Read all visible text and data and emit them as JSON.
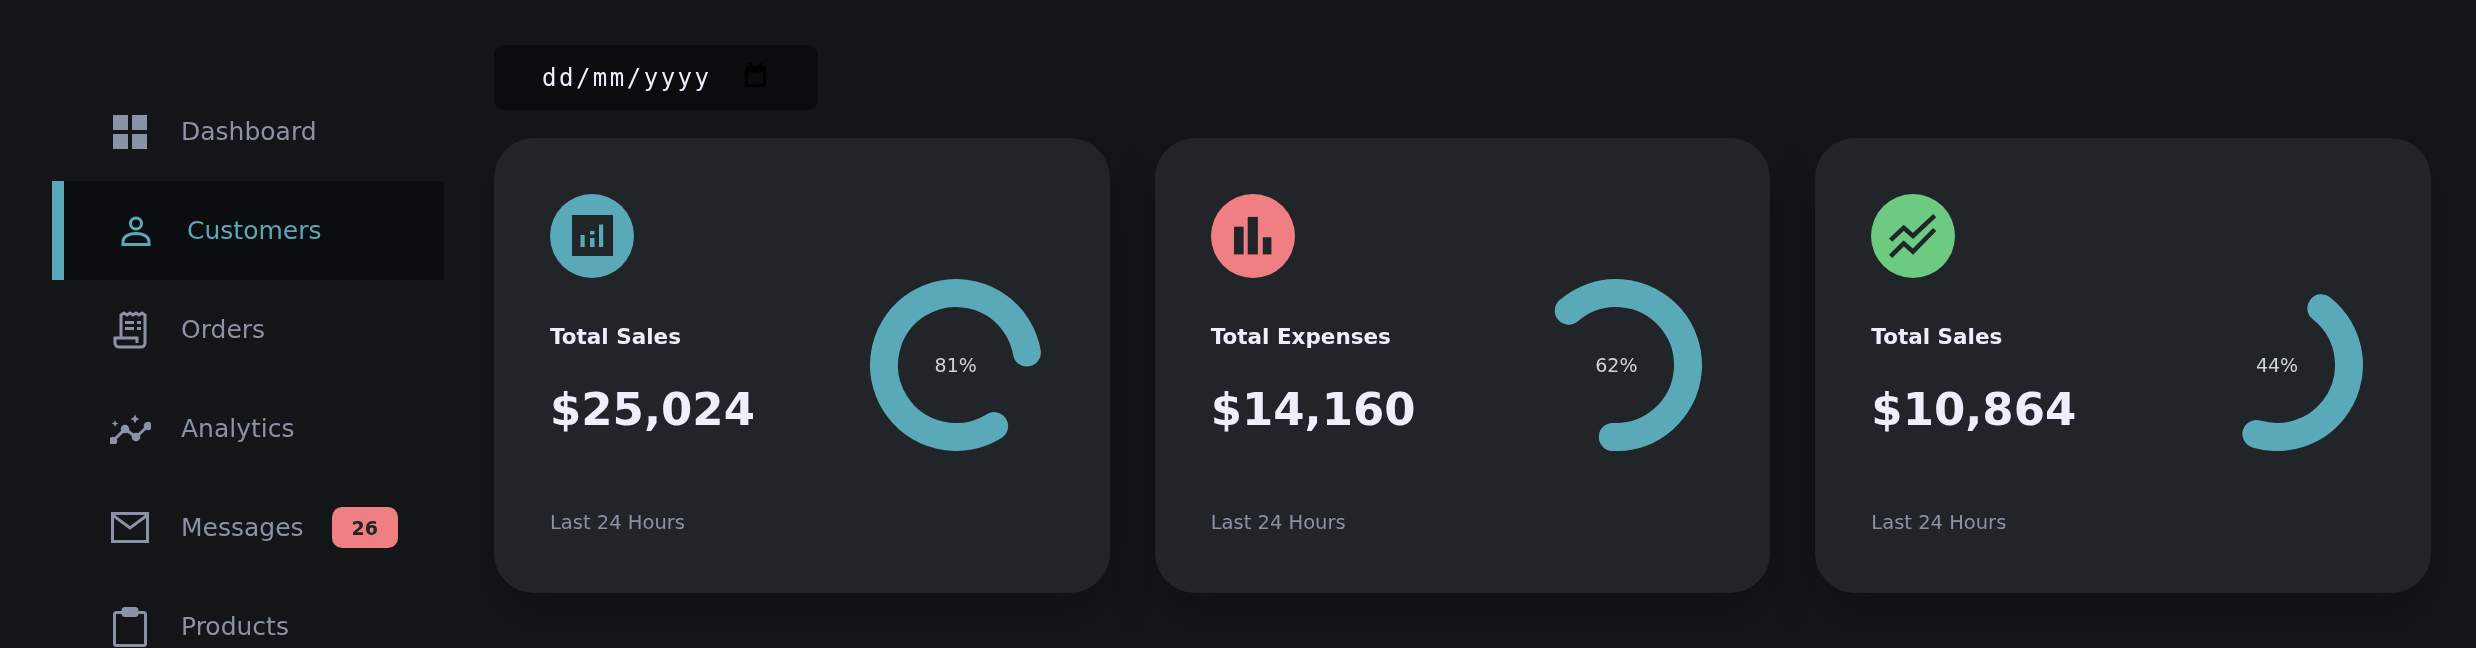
{
  "sidebar": {
    "items": [
      {
        "label": "Dashboard",
        "selected": false
      },
      {
        "label": "Customers",
        "selected": true
      },
      {
        "label": "Orders",
        "selected": false
      },
      {
        "label": "Analytics",
        "selected": false
      },
      {
        "label": "Messages",
        "selected": false,
        "badge": "26"
      },
      {
        "label": "Products",
        "selected": false
      }
    ]
  },
  "date_field": {
    "placeholder": "dd/mm/yyyy"
  },
  "cards": [
    {
      "title": "Total Sales",
      "amount": "$25,024",
      "period": "Last 24 Hours",
      "level": 0.81,
      "reading": "81%",
      "color": "#5aa9b8"
    },
    {
      "title": "Total Expenses",
      "amount": "$14,160",
      "period": "Last 24 Hours",
      "level": 0.62,
      "reading": "62%",
      "color": "#f07f84"
    },
    {
      "title": "Total Sales",
      "amount": "$10,864",
      "period": "Last 24 Hours",
      "level": 0.44,
      "reading": "44%",
      "color": "#6ccb81"
    }
  ]
}
